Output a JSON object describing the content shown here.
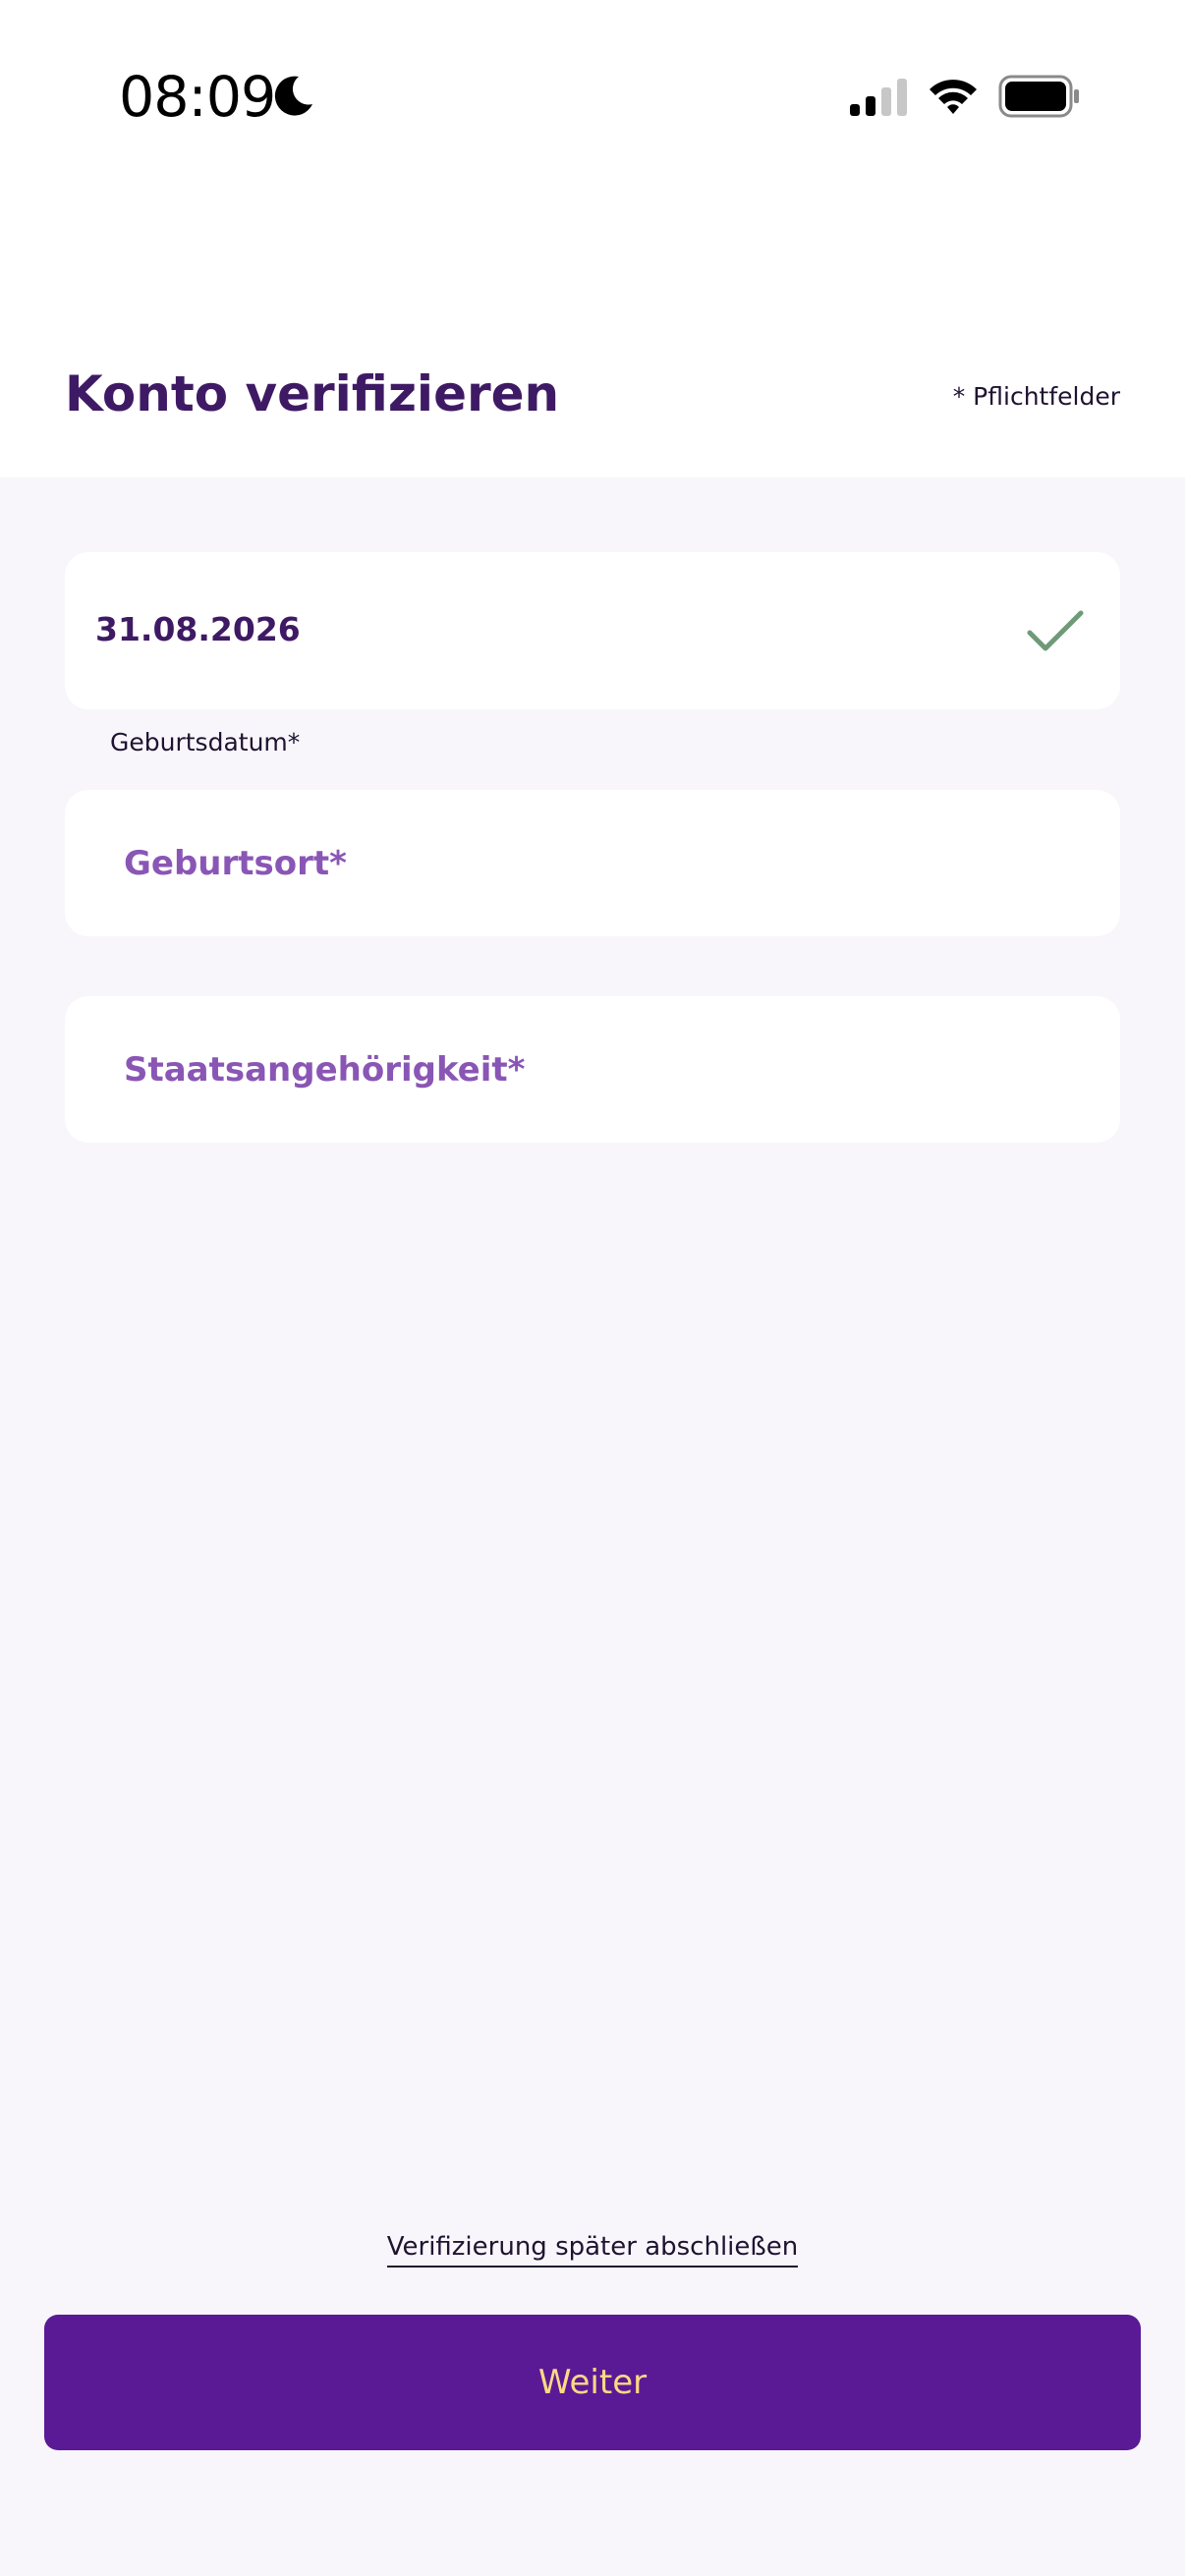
{
  "status_bar": {
    "time": "08:09",
    "icons": [
      "moon-icon",
      "cellular-signal-icon",
      "wifi-icon",
      "battery-icon"
    ]
  },
  "header": {
    "title": "Konto verifizieren",
    "required_note": "* Pflichtfelder"
  },
  "form": {
    "birth_date": {
      "value": "31.08.2026",
      "caption": "Geburtsdatum*",
      "status_icon": "check-icon"
    },
    "birth_place": {
      "placeholder": "Geburtsort*",
      "value": ""
    },
    "nationality": {
      "placeholder": "Staatsangehörigkeit*",
      "value": ""
    }
  },
  "footer": {
    "later_link": "Verifizierung später abschließen",
    "primary_button": "Weiter"
  },
  "colors": {
    "brand_purple": "#5a1a96",
    "title_purple": "#3f1a64",
    "placeholder_purple": "#8a56b5",
    "button_text": "#ffd884",
    "check_green": "#6f9a78",
    "background": "#f8f6fb"
  }
}
